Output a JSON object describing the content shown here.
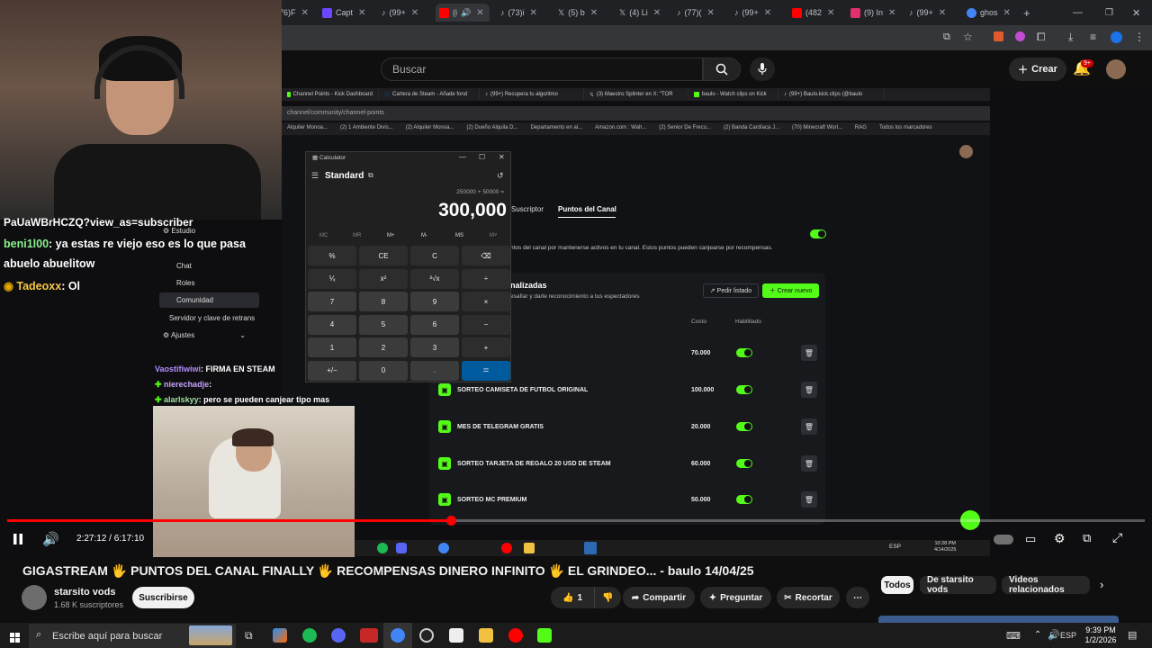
{
  "browser": {
    "tabs": [
      {
        "label": "76)F"
      },
      {
        "label": "Capt"
      },
      {
        "label": "(99+"
      },
      {
        "label": "(i"
      },
      {
        "label": "(73)i"
      },
      {
        "label": "(5) b"
      },
      {
        "label": "(4) Li"
      },
      {
        "label": "(77)("
      },
      {
        "label": "(99+"
      },
      {
        "label": "(482"
      },
      {
        "label": "(9) In"
      },
      {
        "label": "(99+"
      },
      {
        "label": "ghos"
      }
    ],
    "new_tab": "+"
  },
  "youtube": {
    "search_placeholder": "Buscar",
    "create_label": "Crear",
    "notifications_badge": "9+"
  },
  "stream": {
    "inner_tabs": [
      "Channel Points - Kick Dashboard",
      "Cartera de Steam - Añade fond",
      "(99+) Recupera tu algoritmo",
      "(3) Maestro Splinter en X: \"TOR",
      "baulo - Watch clips on Kick",
      "(99+) Baulo.kick.clips (@baulo"
    ],
    "inner_url": "channel/community/channel-points",
    "bookmarks": [
      "Alquiler Monoa...",
      "(2) 1 Ambiente Divis...",
      "(2) Alquiler Monoa...",
      "(2) Dueño Alquila D...",
      "Departamento en al...",
      "Amazon.com : Wah...",
      "(2) Senior De Frecu...",
      "(2) Banda Cardíaca J...",
      "(70) Minecraft Worl...",
      "RAG",
      "Todos los marcadores"
    ],
    "chat": {
      "top_line": "PaUaWBrHCZQ?view_as=subscriber",
      "messages": [
        {
          "user": "beni1l00",
          "text": ": ya estas re viejo eso es lo que pasa"
        },
        {
          "user": "",
          "text": "abuelo abuelitow"
        },
        {
          "user": "Tadeoxx",
          "text": ": Ol"
        }
      ],
      "small_messages": [
        {
          "user": "Vaostifiwiwi",
          "text": ": FIRMA EN STEAM"
        },
        {
          "user": "nierechadje",
          "text": ":"
        },
        {
          "user": "alarlskyy",
          "text": ": pero se pueden canjear tipo mas"
        }
      ]
    },
    "kick_menu": {
      "items": [
        "Estudio",
        "Chat",
        "Roles",
        "Comunidad",
        "Servidor y clave de retrans",
        "Ajustes"
      ]
    },
    "kick_page": {
      "tab_subscriber": "Suscriptor",
      "tab_points": "Puntos del Canal",
      "description": "ntos del canal por mantenerse activos en tu canal. Estos puntos pueden canjearse por recompensas.",
      "section_title": "nalizadas",
      "section_sub": "esafiar y darle reconocimiento a tus espectadores",
      "request_btn": "Pedir listado",
      "new_btn": "Crear nuevo",
      "col_cost": "Costo",
      "col_enabled": "Habilitado",
      "rewards": [
        {
          "name": "",
          "cost": "70.000"
        },
        {
          "name": "SORTEO CAMISETA DE FUTBOL ORIGINAL",
          "cost": "100.000"
        },
        {
          "name": "MES DE TELEGRAM GRATIS",
          "cost": "20.000"
        },
        {
          "name": "SORTEO TARJETA DE REGALO 20 USD DE STEAM",
          "cost": "60.000"
        },
        {
          "name": "SORTEO MC PREMIUM",
          "cost": "50.000"
        }
      ]
    },
    "calculator": {
      "title": "Calculator",
      "mode": "Standard",
      "expression": "250000 + 50000 =",
      "display": "300,000",
      "memory": [
        "MC",
        "MR",
        "M+",
        "M-",
        "MS",
        "M˅"
      ],
      "keys": [
        [
          "%",
          "CE",
          "C",
          "⌫"
        ],
        [
          "⅟ₓ",
          "x²",
          "²√x",
          "÷"
        ],
        [
          "7",
          "8",
          "9",
          "×"
        ],
        [
          "4",
          "5",
          "6",
          "−"
        ],
        [
          "1",
          "2",
          "3",
          "+"
        ],
        [
          "+/−",
          "0",
          ".",
          "="
        ]
      ]
    },
    "inner_clock": {
      "time": "10:28 PM",
      "date": "4/14/2025"
    }
  },
  "player": {
    "time_current": "2:27:12",
    "time_total": "6:17:10",
    "progress_fraction": 0.3899
  },
  "video": {
    "title": "GIGASTREAM 🖐 PUNTOS DEL CANAL FINALLY 🖐 RECOMPENSAS DINERO INFINITO 🖐 EL GRINDEO... - baulo 14/04/25",
    "channel_name": "starsito vods",
    "subscribers": "1.68 K suscriptores",
    "subscribe_label": "Suscribirse",
    "like_count": "1",
    "share_label": "Compartir",
    "ask_label": "Preguntar",
    "clip_label": "Recortar"
  },
  "chips": [
    "Todos",
    "De starsito vods",
    "Videos relacionados"
  ],
  "taskbar": {
    "search_placeholder": "Escribe aquí para buscar",
    "lang": "ESP",
    "time": "9:39 PM",
    "date": "1/2/2026"
  },
  "colors": {
    "kick_green": "#53fc18",
    "youtube_red": "#ff0000",
    "calc_accent": "#005a9e"
  }
}
